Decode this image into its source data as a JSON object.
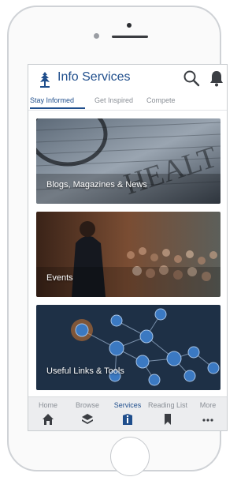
{
  "app": {
    "title": "Info Services"
  },
  "tabs": [
    {
      "label": "Stay Informed",
      "active": true
    },
    {
      "label": "Get Inspired",
      "active": false
    },
    {
      "label": "Compete",
      "active": false
    }
  ],
  "cards": [
    {
      "label": "Blogs, Magazines & News"
    },
    {
      "label": "Events"
    },
    {
      "label": "Useful Links & Tools"
    }
  ],
  "bottom_nav": [
    {
      "label": "Home",
      "icon": "home-icon",
      "active": false
    },
    {
      "label": "Browse",
      "icon": "layers-icon",
      "active": false
    },
    {
      "label": "Services",
      "icon": "info-icon",
      "active": true
    },
    {
      "label": "Reading List",
      "icon": "bookmark-icon",
      "active": false
    },
    {
      "label": "More",
      "icon": "more-icon",
      "active": false
    }
  ],
  "colors": {
    "accent": "#1f4e8c",
    "inactive": "#8a8f96",
    "nav_bg": "#ecedef"
  }
}
